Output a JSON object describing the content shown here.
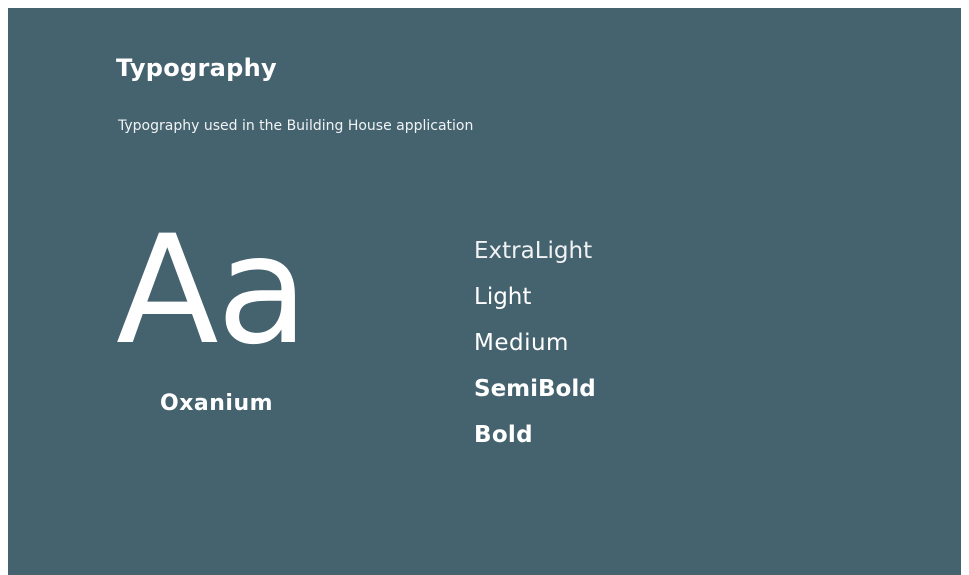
{
  "header": {
    "title": "Typography",
    "subtitle": "Typography used in the Building House application"
  },
  "specimen": {
    "glyph": "Aa",
    "font_name": "Oxanium"
  },
  "weights": [
    "ExtraLight",
    "Light",
    "Medium",
    "SemiBold",
    "Bold"
  ],
  "colors": {
    "background": "#45626f",
    "text": "#ffffff",
    "page": "#ffffff"
  }
}
